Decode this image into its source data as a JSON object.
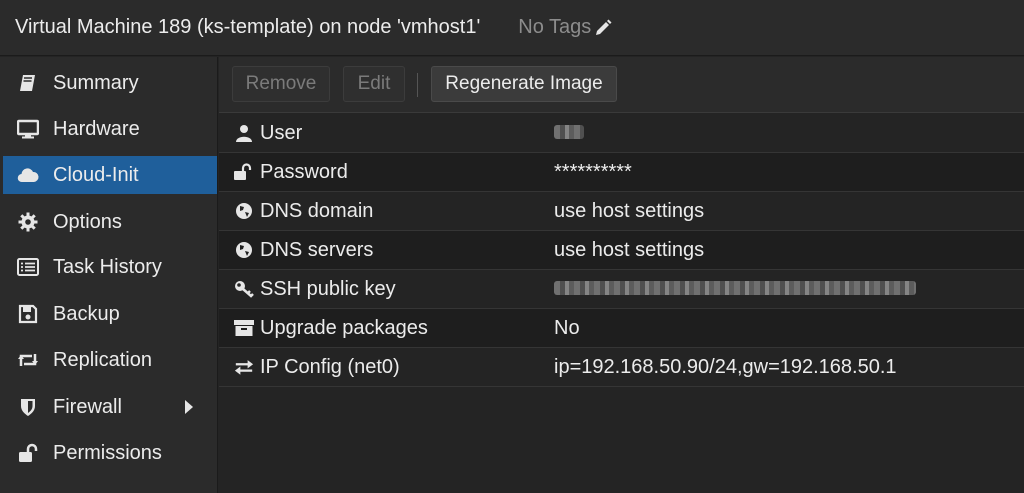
{
  "header": {
    "title": "Virtual Machine 189 (ks-template) on node 'vmhost1'",
    "tags": "No Tags"
  },
  "sidebar": {
    "items": [
      {
        "label": "Summary",
        "icon": "book-icon"
      },
      {
        "label": "Hardware",
        "icon": "desktop-icon"
      },
      {
        "label": "Cloud-Init",
        "icon": "cloud-icon",
        "active": true
      },
      {
        "label": "Options",
        "icon": "gear-icon"
      },
      {
        "label": "Task History",
        "icon": "list-icon"
      },
      {
        "label": "Backup",
        "icon": "floppy-icon"
      },
      {
        "label": "Replication",
        "icon": "retweet-icon"
      },
      {
        "label": "Firewall",
        "icon": "shield-icon",
        "expandable": true
      },
      {
        "label": "Permissions",
        "icon": "unlock-icon"
      }
    ]
  },
  "toolbar": {
    "remove_label": "Remove",
    "edit_label": "Edit",
    "regenerate_label": "Regenerate Image"
  },
  "rows": [
    {
      "key": "User",
      "icon": "user-icon",
      "value": "",
      "redacted": true
    },
    {
      "key": "Password",
      "icon": "unlock-icon",
      "value": "**********"
    },
    {
      "key": "DNS domain",
      "icon": "globe-icon",
      "value": "use host settings"
    },
    {
      "key": "DNS servers",
      "icon": "globe-icon",
      "value": "use host settings"
    },
    {
      "key": "SSH public key",
      "icon": "key-icon",
      "value": "",
      "redacted": true
    },
    {
      "key": "Upgrade packages",
      "icon": "archive-icon",
      "value": "No"
    },
    {
      "key": "IP Config (net0)",
      "icon": "exchange-icon",
      "value": "ip=192.168.50.90/24,gw=192.168.50.1"
    }
  ],
  "colors": {
    "active_nav": "#1f5f9b",
    "background": "#242424"
  }
}
